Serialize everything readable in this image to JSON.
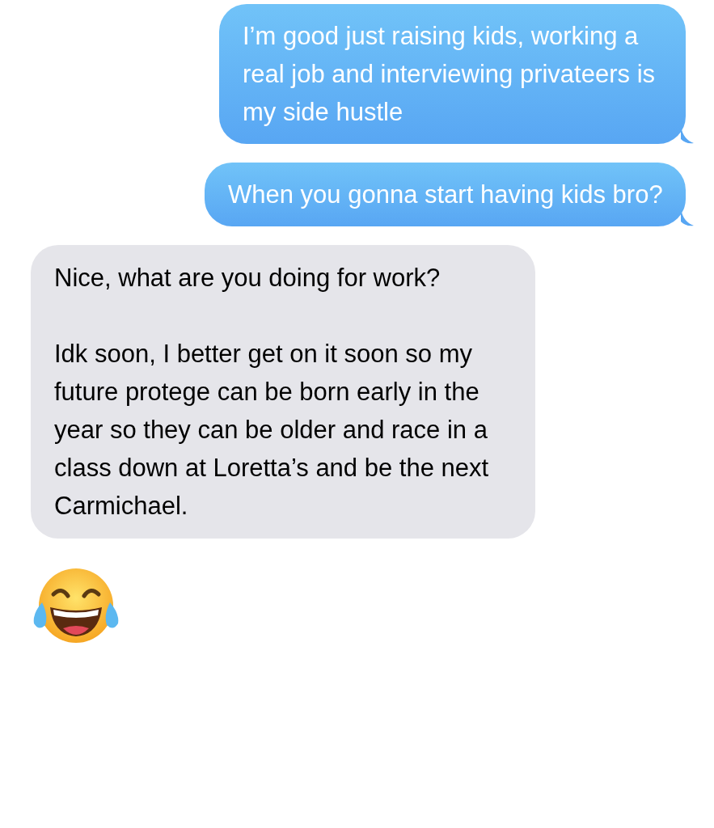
{
  "messages": [
    {
      "kind": "outgoing",
      "paragraphs": [
        "I’m good just raising kids, working a real job and interviewing privateers is my side hustle"
      ]
    },
    {
      "kind": "outgoing",
      "paragraphs": [
        "When you gonna start having kids bro?"
      ]
    },
    {
      "kind": "incoming",
      "paragraphs": [
        "Nice, what are you doing for work?",
        "Idk soon, I better get on it soon so my future protege can be born early in the year so they can be older and race in a class down at Loretta’s and be the next Carmichael."
      ]
    },
    {
      "kind": "emoji"
    }
  ]
}
